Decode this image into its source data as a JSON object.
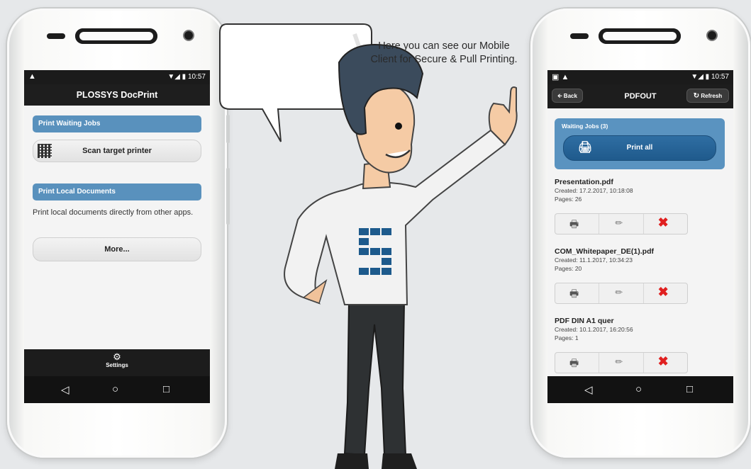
{
  "left_phone": {
    "status_time": "10:57",
    "title": "PLOSSYS DocPrint",
    "section_waiting": "Print Waiting Jobs",
    "scan_button": "Scan target printer",
    "section_local": "Print Local Documents",
    "local_description": "Print local documents directly from other apps.",
    "more_button": "More...",
    "settings_label": "Settings",
    "settings_icon": "gear-icon"
  },
  "right_phone": {
    "status_time": "10:57",
    "title": "PDFOUT",
    "back_label": "Back",
    "refresh_label": "Refresh",
    "waiting_header": "Waiting Jobs (3)",
    "print_all_label": "Print all",
    "jobs": [
      {
        "name": "Presentation.pdf",
        "created": "Created: 17.2.2017, 10:18:08",
        "pages": "Pages: 26"
      },
      {
        "name": "COM_Whitepaper_DE(1).pdf",
        "created": "Created: 11.1.2017, 10:34:23",
        "pages": "Pages: 20"
      },
      {
        "name": "PDF DIN A1 quer",
        "created": "Created: 10.1.2017, 16:20:56",
        "pages": "Pages: 1"
      }
    ]
  },
  "caption": "Here you can see our Mobile Client for Secure & Pull Printing.",
  "nav_icons": [
    "back-triangle-icon",
    "home-circle-icon",
    "recents-square-icon"
  ],
  "colors": {
    "accent_blue": "#5a93c0",
    "dark_bar": "#1c1c1c",
    "delete_red": "#e02020"
  }
}
